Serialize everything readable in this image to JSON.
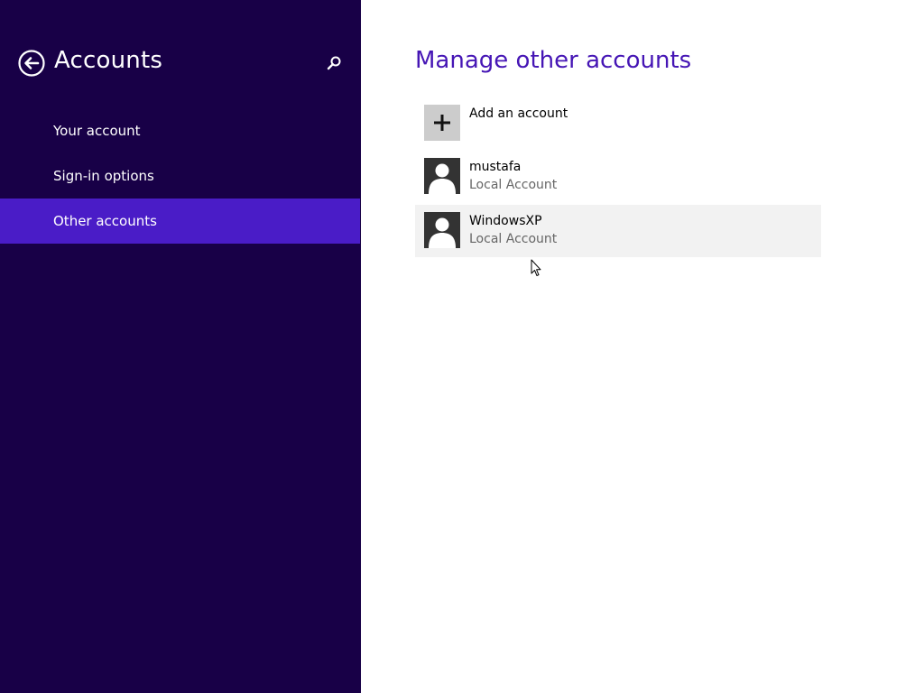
{
  "sidebar": {
    "title": "Accounts",
    "back_icon": "back-arrow-icon",
    "search_icon": "search-icon",
    "items": [
      {
        "label": "Your account",
        "active": false
      },
      {
        "label": "Sign-in options",
        "active": false
      },
      {
        "label": "Other accounts",
        "active": true
      }
    ]
  },
  "main": {
    "title": "Manage other accounts",
    "add_account": {
      "label": "Add an account",
      "icon": "plus-icon"
    },
    "accounts": [
      {
        "name": "mustafa",
        "type": "Local Account",
        "icon": "user-avatar-icon"
      },
      {
        "name": "WindowsXP",
        "type": "Local Account",
        "icon": "user-avatar-icon",
        "hovered": true
      }
    ]
  },
  "colors": {
    "sidebar_bg": "#180047",
    "sidebar_active": "#4a1cc7",
    "title_accent": "#4616b5",
    "hover_bg": "#f2f2f2"
  }
}
